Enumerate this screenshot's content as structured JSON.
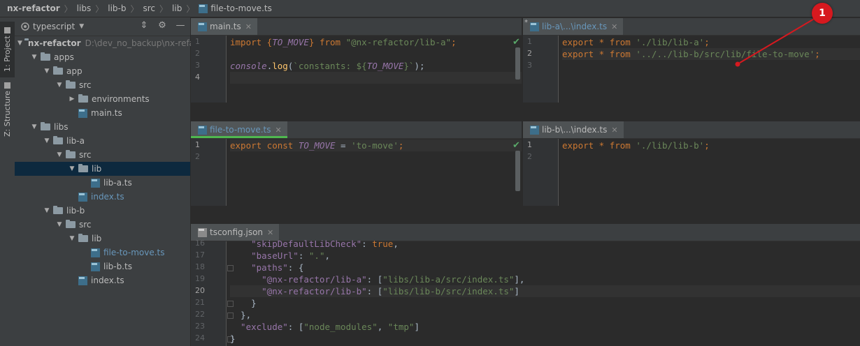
{
  "breadcrumb": [
    "nx-refactor",
    "libs",
    "lib-b",
    "src",
    "lib",
    "file-to-move.ts"
  ],
  "toolstrip": {
    "project_tab": "1: Project",
    "structure_tab": "Z: Structure"
  },
  "project": {
    "header_label": "typescript",
    "tree": [
      {
        "label": "nx-refactor",
        "path": "D:\\dev_no_backup\\nx-refa",
        "type": "folder",
        "depth": 0,
        "arrow": "open",
        "bold": true
      },
      {
        "label": "apps",
        "type": "folder",
        "depth": 1,
        "arrow": "open"
      },
      {
        "label": "app",
        "type": "folder",
        "depth": 2,
        "arrow": "open"
      },
      {
        "label": "src",
        "type": "folder",
        "depth": 3,
        "arrow": "open"
      },
      {
        "label": "environments",
        "type": "folder",
        "depth": 4,
        "arrow": "closed"
      },
      {
        "label": "main.ts",
        "type": "ts",
        "depth": 4,
        "arrow": "none"
      },
      {
        "label": "libs",
        "type": "folder",
        "depth": 1,
        "arrow": "open"
      },
      {
        "label": "lib-a",
        "type": "folder",
        "depth": 2,
        "arrow": "open"
      },
      {
        "label": "src",
        "type": "folder",
        "depth": 3,
        "arrow": "open"
      },
      {
        "label": "lib",
        "type": "folder",
        "depth": 4,
        "arrow": "open",
        "selected": true
      },
      {
        "label": "lib-a.ts",
        "type": "ts",
        "depth": 5,
        "arrow": "none"
      },
      {
        "label": "index.ts",
        "type": "ts",
        "depth": 4,
        "arrow": "none",
        "modified": true
      },
      {
        "label": "lib-b",
        "type": "folder",
        "depth": 2,
        "arrow": "open"
      },
      {
        "label": "src",
        "type": "folder",
        "depth": 3,
        "arrow": "open"
      },
      {
        "label": "lib",
        "type": "folder",
        "depth": 4,
        "arrow": "open"
      },
      {
        "label": "file-to-move.ts",
        "type": "ts",
        "depth": 5,
        "arrow": "none",
        "modified": true
      },
      {
        "label": "lib-b.ts",
        "type": "ts",
        "depth": 5,
        "arrow": "none"
      },
      {
        "label": "index.ts",
        "type": "ts",
        "depth": 4,
        "arrow": "none"
      }
    ]
  },
  "editors": {
    "main": {
      "tab": "main.ts",
      "lines": [
        "1",
        "2",
        "3",
        "4"
      ]
    },
    "lib_a_index": {
      "tab": "lib-a\\...\\index.ts",
      "lines": [
        "1",
        "2",
        "3"
      ]
    },
    "file_to_move": {
      "tab": "file-to-move.ts",
      "lines": [
        "1",
        "2"
      ]
    },
    "lib_b_index": {
      "tab": "lib-b\\...\\index.ts",
      "lines": [
        "1",
        "2"
      ]
    },
    "tsconfig": {
      "tab": "tsconfig.json",
      "lines": [
        "16",
        "17",
        "18",
        "19",
        "20",
        "21",
        "22",
        "23",
        "24"
      ]
    }
  },
  "code": {
    "main": {
      "l1": [
        "import {",
        "TO_MOVE",
        "} from ",
        "\"@nx-refactor/lib-a\"",
        ";"
      ],
      "l3": [
        "console",
        ".",
        "log",
        "(",
        "`constants: ${",
        "TO_MOVE",
        "}`",
        ");"
      ]
    },
    "lib_a": {
      "l1": [
        "export * from ",
        "'./lib/lib-a'",
        ";"
      ],
      "l2": [
        "export * from ",
        "'../../lib-b/src/lib/file-to-move'",
        ";"
      ]
    },
    "file_to_move": {
      "l1": [
        "export const ",
        "TO_MOVE",
        " = ",
        "'to-move'",
        ";"
      ]
    },
    "lib_b": {
      "l1": [
        "export * from ",
        "'./lib/lib-b'",
        ";"
      ]
    },
    "tsconfig": {
      "l16": [
        "    \"skipDefaultLibCheck\"",
        ": ",
        "true",
        ","
      ],
      "l17": [
        "    \"baseUrl\"",
        ": ",
        "\".\"",
        ","
      ],
      "l18": [
        "    \"paths\"",
        ": {"
      ],
      "l19": [
        "      \"@nx-refactor/lib-a\"",
        ": [",
        "\"libs/lib-a/src/index.ts\"",
        "],"
      ],
      "l20": [
        "      \"@nx-refactor/lib-b\"",
        ": [",
        "\"libs/lib-b/src/index.ts\"",
        "]"
      ],
      "l21": [
        "    }"
      ],
      "l22": [
        "  },"
      ],
      "l23": [
        "  \"exclude\"",
        ": [",
        "\"node_modules\"",
        ", ",
        "\"tmp\"",
        "]"
      ],
      "l24": [
        "}"
      ]
    }
  },
  "annotation": {
    "number": "1"
  },
  "colors": {
    "keyword": "#cc7832",
    "string": "#6a8759",
    "constant": "#9876aa",
    "accent_line": "#4fb84f",
    "annotation": "#d6191f"
  }
}
